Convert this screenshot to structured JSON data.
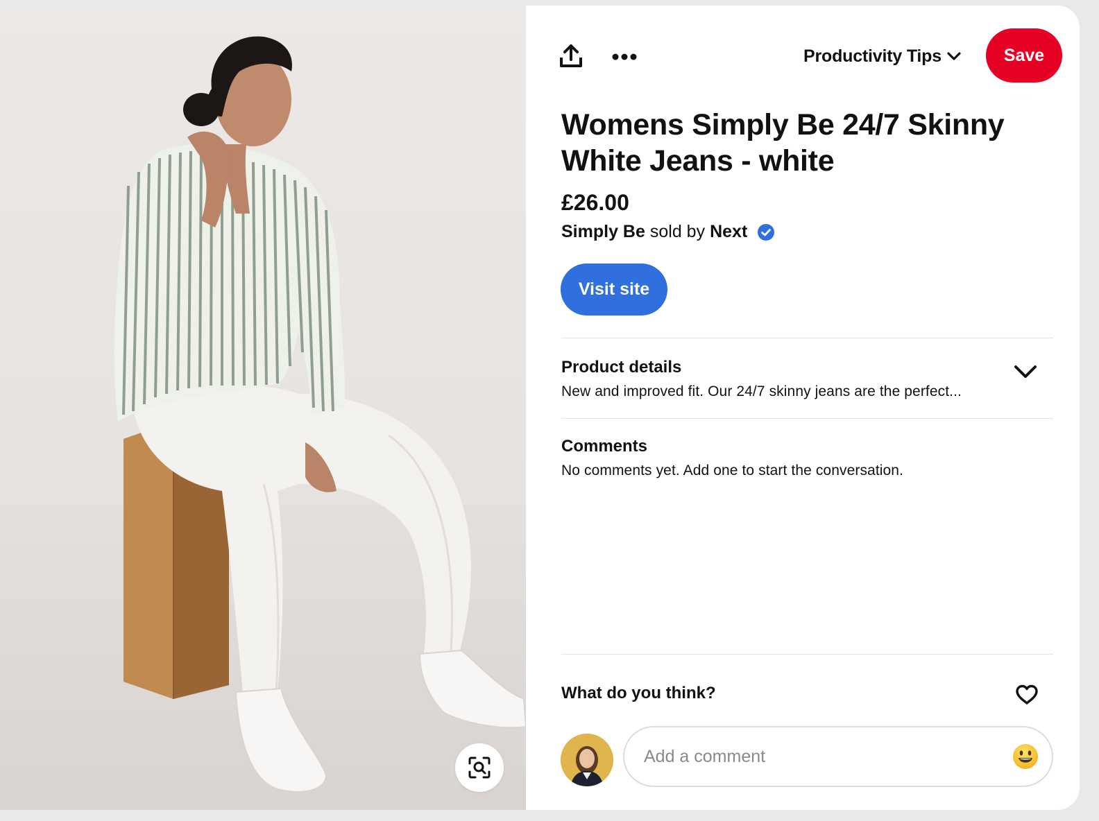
{
  "header": {
    "share_icon": "share-upload-icon",
    "more_icon": "more-dots-icon",
    "board_name": "Productivity Tips",
    "save_label": "Save"
  },
  "pin": {
    "title": "Womens Simply Be 24/7 Skinny White Jeans - white",
    "price": "£26.00",
    "brand": "Simply Be",
    "sold_by_label": "sold by",
    "merchant": "Next",
    "visit_label": "Visit site"
  },
  "details": {
    "heading": "Product details",
    "text": "New and improved fit. Our 24/7 skinny jeans are the perfect..."
  },
  "comments": {
    "heading": "Comments",
    "empty_text": "No comments yet. Add one to start the conversation."
  },
  "feedback": {
    "prompt": "What do you think?",
    "input_placeholder": "Add a comment"
  },
  "colors": {
    "save": "#e60023",
    "visit": "#2f6fde",
    "verified": "#2f6fde"
  }
}
